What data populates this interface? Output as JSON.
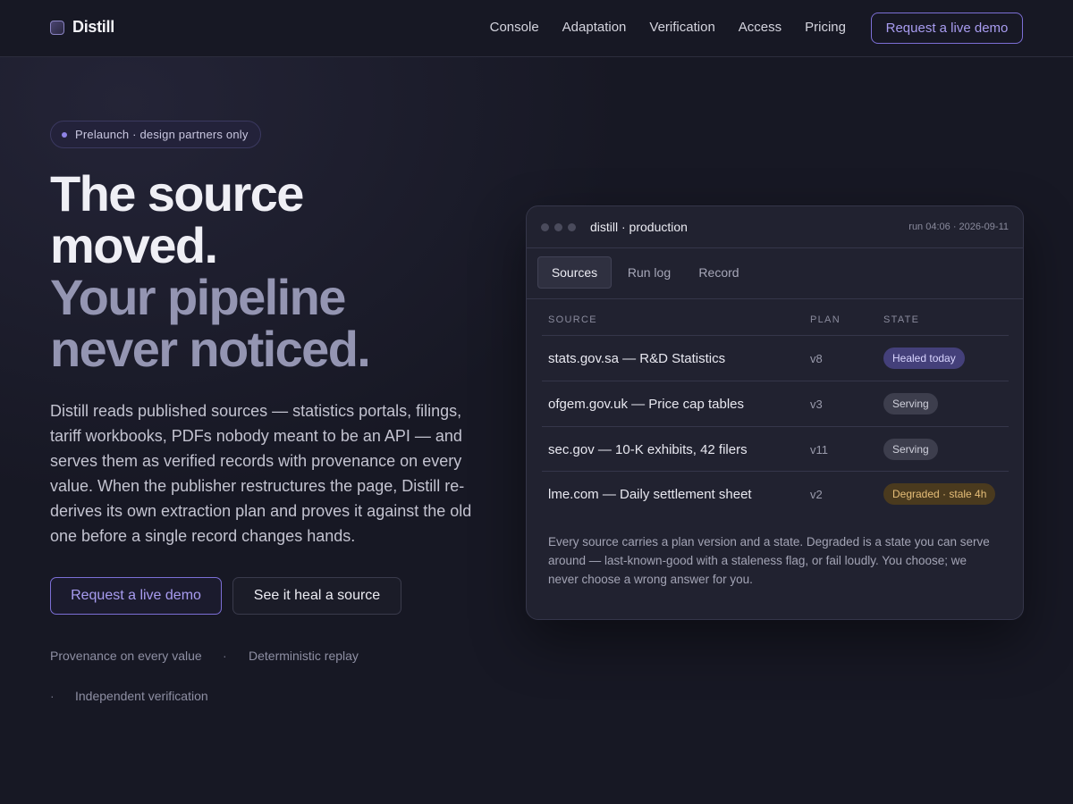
{
  "nav": {
    "brand": "Distill",
    "links": [
      "Console",
      "Adaptation",
      "Verification",
      "Access",
      "Pricing"
    ],
    "cta": "Request a live demo"
  },
  "hero": {
    "pill": "Prelaunch · design partners only",
    "headline_line1": "The source moved.",
    "headline_line2": "Your pipeline never noticed.",
    "lede": "Distill reads published sources — statistics portals, filings, tariff workbooks, PDFs nobody meant to be an API — and serves them as verified records with provenance on every value. When the publisher restructures the page, Distill re-derives its own extraction plan and proves it against the old one before a single record changes hands.",
    "primary_button": "Request a live demo",
    "secondary_button": "See it heal a source",
    "features": [
      "Provenance on every value",
      "Deterministic replay",
      "Independent verification"
    ],
    "separator": "·"
  },
  "panel": {
    "title": "distill · production",
    "meta": "run 04:06 · 2026-09-11",
    "tabs": [
      "Sources",
      "Run log",
      "Record"
    ],
    "columns": [
      "SOURCE",
      "PLAN",
      "STATE"
    ],
    "rows": [
      {
        "source": "stats.gov.sa — R&D Statistics",
        "plan": "v8",
        "state": "Healed today",
        "kind": "healed"
      },
      {
        "source": "ofgem.gov.uk — Price cap tables",
        "plan": "v3",
        "state": "Serving",
        "kind": "serving"
      },
      {
        "source": "sec.gov — 10-K exhibits, 42 filers",
        "plan": "v11",
        "state": "Serving",
        "kind": "serving"
      },
      {
        "source": "lme.com — Daily settlement sheet",
        "plan": "v2",
        "state": "Degraded · stale 4h",
        "kind": "degraded"
      }
    ],
    "note": "Every source carries a plan version and a state. Degraded is a state you can serve around — last-known-good with a staleness flag, or fail loudly. You choose; we never choose a wrong answer for you."
  },
  "colors": {
    "background": "#171824",
    "accent": "#a89cf0",
    "healed": "#44407a",
    "degraded": "#e6be78"
  }
}
